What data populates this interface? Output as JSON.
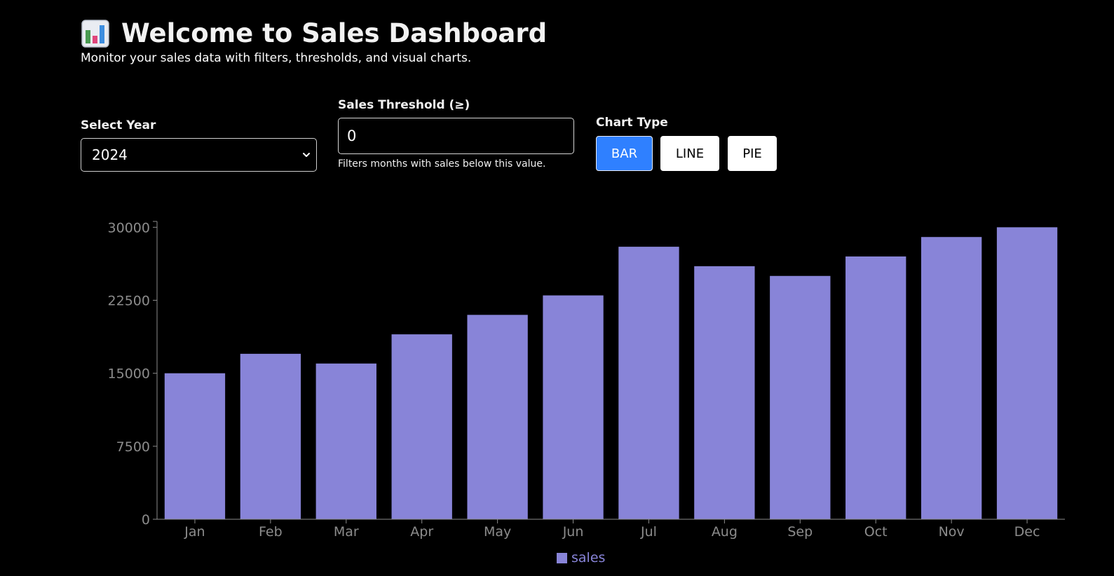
{
  "header": {
    "title": "Welcome to Sales Dashboard",
    "subtitle": "Monitor your sales data with filters, thresholds, and visual charts."
  },
  "controls": {
    "year_label": "Select Year",
    "year_value": "2024",
    "threshold_label": "Sales Threshold (≥)",
    "threshold_value": "0",
    "threshold_help": "Filters months with sales below this value.",
    "chart_type_label": "Chart Type",
    "chart_types": [
      "BAR",
      "LINE",
      "PIE"
    ],
    "active_chart_type": "BAR"
  },
  "colors": {
    "bar": "#8884d8",
    "active_button": "#2f80ff",
    "axis": "#8c8c8c",
    "background": "#000000"
  },
  "icons": {
    "title": "bar-chart-icon",
    "select": "chevron-down-icon"
  },
  "chart_data": {
    "type": "bar",
    "categories": [
      "Jan",
      "Feb",
      "Mar",
      "Apr",
      "May",
      "Jun",
      "Jul",
      "Aug",
      "Sep",
      "Oct",
      "Nov",
      "Dec"
    ],
    "series": [
      {
        "name": "sales",
        "values": [
          15000,
          17000,
          16000,
          19000,
          21000,
          23000,
          28000,
          26000,
          25000,
          27000,
          29000,
          30000
        ]
      }
    ],
    "yticks": [
      "0",
      "7500",
      "15000",
      "22500",
      "30000"
    ],
    "ylim": [
      0,
      30000
    ],
    "grid": false,
    "legend": "bottom-center"
  }
}
